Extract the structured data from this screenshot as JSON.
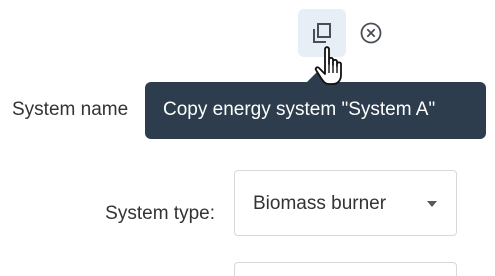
{
  "toolbar": {
    "copy_icon": "copy-icon",
    "close_icon": "close-circle-icon",
    "copy_tooltip": "Copy energy system \"System A\""
  },
  "form": {
    "system_name_label": "System name",
    "system_type_label": "System type:",
    "system_type_value": "Biomass burner"
  },
  "colors": {
    "tooltip_bg": "#2d3d4d",
    "icon_hover_bg": "#e7eef5",
    "text": "#333333",
    "border": "#d5d9de"
  }
}
